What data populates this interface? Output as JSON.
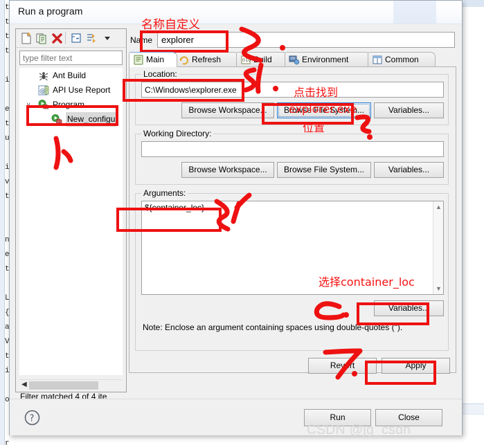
{
  "window": {
    "title": "Run a program",
    "titlebar_icon": "toolbox-icon"
  },
  "background_editor": {
    "code_fragment": "t\nt\nt\nt\n\ni\n\ne\nt\nu\n\ni\nv\nt\n\n\nn\ne\nt\n\nL\n{\na\nV\nt\ni\n\no\n\n\nr\ni\nt\n\ni\ni\ne\n(\n\n\n\n{"
  },
  "left_panel": {
    "toolbar": [
      {
        "name": "new-launch-configuration-icon",
        "label": "New"
      },
      {
        "name": "duplicate-launch-configuration-icon",
        "label": "Duplicate"
      },
      {
        "name": "delete-launch-configuration-icon",
        "label": "Delete"
      },
      {
        "name": "collapse-all-icon",
        "label": "Collapse All"
      },
      {
        "name": "filter-launch-configurations-icon",
        "label": "Filter"
      },
      {
        "name": "view-menu-chevron-down-icon",
        "label": "View Menu"
      }
    ],
    "filter": {
      "value": "",
      "placeholder": "type filter text"
    },
    "tree": [
      {
        "label": "Ant Build",
        "icon": "ant-build-icon",
        "indent": 0,
        "twisty": "",
        "selected": false
      },
      {
        "label": "API Use Report",
        "icon": "api-use-report-icon",
        "indent": 0,
        "twisty": "",
        "selected": false
      },
      {
        "label": "Program",
        "icon": "program-icon",
        "indent": 0,
        "twisty": "∨",
        "selected": false
      },
      {
        "label": "New_configu",
        "icon": "program-config-icon",
        "indent": 1,
        "twisty": "",
        "selected": true
      }
    ],
    "status": "Filter matched 4 of 4 ite"
  },
  "form": {
    "name_label": "Name",
    "name_value": "explorer",
    "tabs": [
      {
        "label": "Main",
        "icon": "main-tab-icon",
        "active": true
      },
      {
        "label": "Refresh",
        "icon": "refresh-tab-icon",
        "active": false
      },
      {
        "label": "Build",
        "icon": "build-tab-icon",
        "active": false
      },
      {
        "label": "Environment",
        "icon": "environment-tab-icon",
        "active": false
      },
      {
        "label": "Common",
        "icon": "common-tab-icon",
        "active": false
      }
    ],
    "location": {
      "group_label": "Location:",
      "value": "C:\\Windows\\explorer.exe",
      "buttons": [
        "Browse Workspace...",
        "Browse File System...",
        "Variables..."
      ]
    },
    "working_directory": {
      "group_label": "Working Directory:",
      "value": "",
      "buttons": [
        "Browse Workspace...",
        "Browse File System...",
        "Variables..."
      ]
    },
    "arguments": {
      "group_label": "Arguments:",
      "value": "${container_loc}",
      "variables_button": "Variables...",
      "note": "Note: Enclose an argument containing spaces using double-quotes (\")."
    },
    "revert_button": "Revert",
    "apply_button": "Apply"
  },
  "footer": {
    "help_icon": "help-question-icon",
    "run_button": "Run",
    "close_button": "Close"
  },
  "watermark": "CSDN @jg_csdn",
  "annotations": {
    "color": "#f71313",
    "steps": [
      {
        "id": "step-1",
        "text": "1、"
      },
      {
        "id": "step-2",
        "text": "2、"
      },
      {
        "id": "step-3",
        "text": "3、"
      },
      {
        "id": "step-4",
        "text": "4、"
      },
      {
        "id": "step-5",
        "text": "5、"
      },
      {
        "id": "step-6",
        "text": "6、"
      },
      {
        "id": "step-7",
        "text": "7、"
      }
    ],
    "notes": [
      {
        "id": "note-name",
        "text": "名称自定义"
      },
      {
        "id": "note-browse-1",
        "text": "点击找到"
      },
      {
        "id": "note-browse-2",
        "text": "explorer.exe"
      },
      {
        "id": "note-browse-3",
        "text": "位置"
      },
      {
        "id": "note-variables",
        "text": "选择container_loc"
      }
    ]
  }
}
